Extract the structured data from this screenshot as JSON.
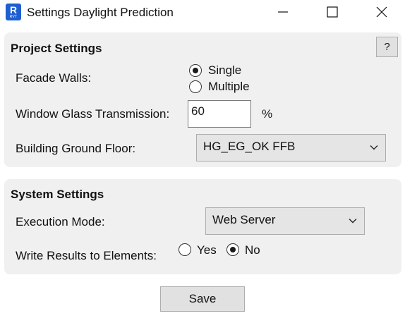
{
  "window": {
    "title": "Settings Daylight Prediction",
    "icon_letter": "R",
    "icon_caption": "RVT",
    "icon_color": "#1d5fd1"
  },
  "project_settings": {
    "title": "Project Settings",
    "help_label": "?",
    "facade_walls": {
      "label": "Facade Walls:",
      "options": [
        "Single",
        "Multiple"
      ],
      "selected": "Single"
    },
    "window_glass": {
      "label": "Window Glass Transmission:",
      "value": "60",
      "unit": "%"
    },
    "ground_floor": {
      "label": "Building Ground Floor:",
      "selected": "HG_EG_OK FFB"
    }
  },
  "system_settings": {
    "title": "System Settings",
    "execution_mode": {
      "label": "Execution Mode:",
      "selected": "Web Server"
    },
    "write_results": {
      "label": "Write Results to Elements:",
      "options": [
        "Yes",
        "No"
      ],
      "selected": "No"
    }
  },
  "footer": {
    "save_label": "Save"
  }
}
